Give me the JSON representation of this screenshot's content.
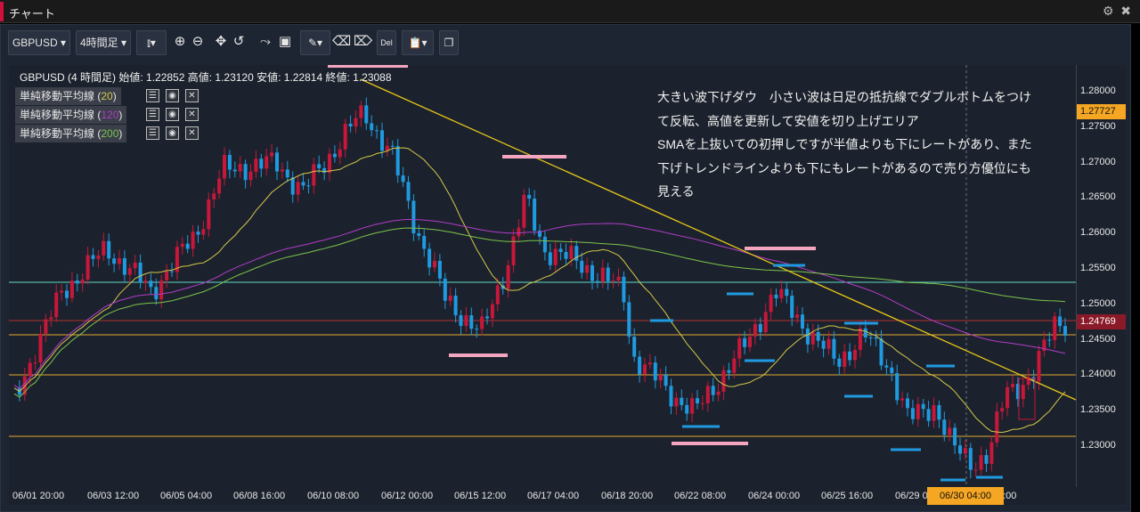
{
  "window": {
    "title": "チャート",
    "settings_icon": "gear-icon",
    "close_icon": "close-icon"
  },
  "toolbar": {
    "symbol": "GBPUSD",
    "timeframe": "4時間足",
    "chart_type_icon": "candlestick-icon",
    "tools": [
      "zoom-in-icon",
      "zoom-out-icon",
      "move-icon",
      "reset-zoom-icon",
      "indicator-icon",
      "save-icon",
      "draw-icon",
      "eraser-icon",
      "erase-all-icon",
      "delete-icon",
      "clipboard-icon",
      "copy-icon"
    ],
    "delete_label": "Del"
  },
  "chart": {
    "header": "GBPUSD (4 時間足) 始値: 1.22852 高値: 1.23120 安値: 1.22814 終値: 1.23088",
    "indicators": [
      {
        "name": "単純移動平均線 (",
        "period": "20",
        "close": ")",
        "color": "#d4c84a"
      },
      {
        "name": "単純移動平均線 (",
        "period": "120",
        "close": ")",
        "color": "#b03cc8"
      },
      {
        "name": "単純移動平均線 (",
        "period": "200",
        "close": ")",
        "color": "#7cc44a"
      }
    ],
    "annotation_lines": [
      "大きい波下げダウ　小さい波は日足の抵抗線でダブルボトムをつけ",
      "て反転、高値を更新して安値を切り上げエリア",
      "SMAを上抜いての初押しですが半値よりも下にレートがあり、また",
      "下げトレンドラインよりも下にもレートがあるので売り方優位にも",
      "見える"
    ]
  },
  "price_axis": {
    "ticks": [
      "1.28000",
      "1.27500",
      "1.27000",
      "1.26500",
      "1.26000",
      "1.25500",
      "1.25000",
      "1.24500",
      "1.24000",
      "1.23500",
      "1.23000"
    ],
    "current_high_badge": "1.27727",
    "current_price_badge": "1.24769",
    "colors": {
      "high_badge": "#f5a623",
      "price_badge": "#8b1a28"
    }
  },
  "time_axis": {
    "ticks": [
      "06/01 20:00",
      "06/03 12:00",
      "06/05 04:00",
      "06/08 16:00",
      "06/10 08:00",
      "06/12 00:00",
      "06/15 12:00",
      "06/17 04:00",
      "06/18 20:00",
      "06/22 08:00",
      "06/24 00:00",
      "06/25 16:00",
      "06/29 0",
      "06/30 04:00",
      "0:00"
    ],
    "crosshair_badge": "06/30 04:00"
  },
  "colors": {
    "bull": "#c8173a",
    "bear": "#1f9ae0",
    "background": "#1c222d",
    "trendline": "#e6c619"
  }
}
